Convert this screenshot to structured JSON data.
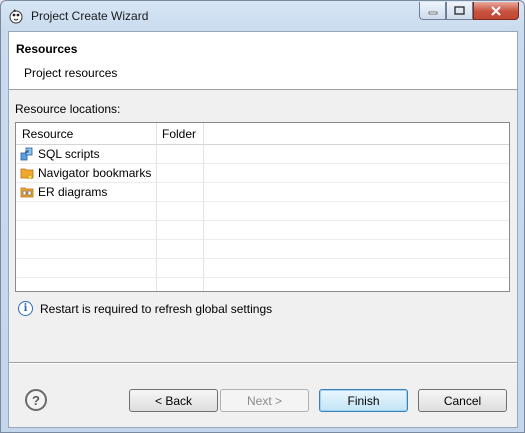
{
  "window": {
    "title": "Project Create Wizard",
    "icon": "dbeaver-beaver-icon"
  },
  "header": {
    "title": "Resources",
    "description": "Project resources"
  },
  "resources": {
    "section_label": "Resource locations:",
    "columns": [
      "Resource",
      "Folder"
    ],
    "rows": [
      {
        "name": "SQL scripts",
        "folder": "",
        "icon": "sql-scripts-icon"
      },
      {
        "name": "Navigator bookmarks",
        "folder": "",
        "icon": "bookmarks-folder-icon"
      },
      {
        "name": "ER diagrams",
        "folder": "",
        "icon": "er-diagram-icon"
      }
    ]
  },
  "info": {
    "message": "Restart is required to refresh global settings"
  },
  "buttons": {
    "help": "?",
    "back": "< Back",
    "next": "Next >",
    "finish": "Finish",
    "cancel": "Cancel"
  },
  "colors": {
    "accent": "#3c7fb1",
    "info": "#2a6ab8"
  }
}
